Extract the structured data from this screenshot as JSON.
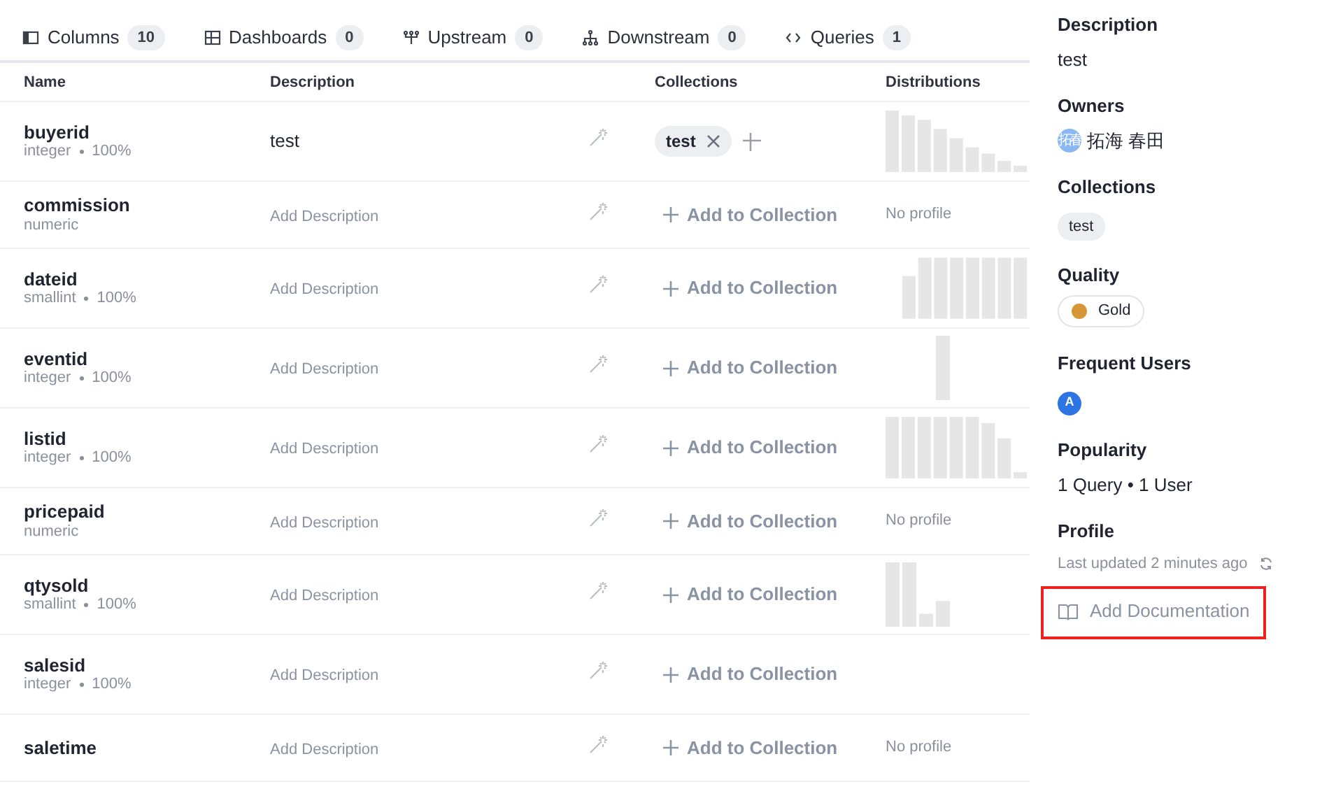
{
  "tabs": [
    {
      "label": "Columns",
      "count": "10"
    },
    {
      "label": "Dashboards",
      "count": "0"
    },
    {
      "label": "Upstream",
      "count": "0"
    },
    {
      "label": "Downstream",
      "count": "0"
    },
    {
      "label": "Queries",
      "count": "1"
    }
  ],
  "table": {
    "columns": [
      "Name",
      "Description",
      "Collections",
      "Distributions"
    ],
    "rows": [
      {
        "name": "buyerid",
        "type": "integer",
        "completeness": "100%",
        "description": "test",
        "collections": [
          "test"
        ],
        "distribution": {
          "kind": "histogram"
        }
      },
      {
        "name": "commission",
        "type": "numeric",
        "description_prompt": "Add Description",
        "add_collection": "Add to Collection",
        "distribution": {
          "kind": "text",
          "text": "No profile"
        }
      },
      {
        "name": "dateid",
        "type": "smallint",
        "completeness": "100%",
        "description_prompt": "Add Description",
        "add_collection": "Add to Collection",
        "distribution": {
          "kind": "histogram"
        }
      },
      {
        "name": "eventid",
        "type": "integer",
        "completeness": "100%",
        "description_prompt": "Add Description",
        "add_collection": "Add to Collection",
        "distribution": {
          "kind": "histogram"
        }
      },
      {
        "name": "listid",
        "type": "integer",
        "completeness": "100%",
        "description_prompt": "Add Description",
        "add_collection": "Add to Collection",
        "distribution": {
          "kind": "histogram"
        }
      },
      {
        "name": "pricepaid",
        "type": "numeric",
        "description_prompt": "Add Description",
        "add_collection": "Add to Collection",
        "distribution": {
          "kind": "text",
          "text": "No profile"
        }
      },
      {
        "name": "qtysold",
        "type": "smallint",
        "completeness": "100%",
        "description_prompt": "Add Description",
        "add_collection": "Add to Collection",
        "distribution": {
          "kind": "histogram"
        }
      },
      {
        "name": "salesid",
        "type": "integer",
        "completeness": "100%",
        "description_prompt": "Add Description",
        "add_collection": "Add to Collection"
      },
      {
        "name": "saletime",
        "description_prompt": "Add Description",
        "add_collection": "Add to Collection",
        "distribution": {
          "kind": "text",
          "text": "No profile"
        }
      }
    ]
  },
  "sidebar": {
    "description": {
      "heading": "Description",
      "text": "test"
    },
    "owners": {
      "heading": "Owners",
      "people": [
        {
          "initials": "拓春",
          "name": "拓海 春田"
        }
      ]
    },
    "collections": {
      "heading": "Collections",
      "tags": [
        "test"
      ]
    },
    "quality": {
      "heading": "Quality",
      "label": "Gold",
      "color": "#d69638"
    },
    "frequent_users": {
      "heading": "Frequent Users",
      "avatars": [
        "A"
      ]
    },
    "popularity": {
      "heading": "Popularity",
      "text": "1 Query • 1 User"
    },
    "profile": {
      "heading": "Profile",
      "updated": "Last updated 2 minutes ago"
    },
    "add_documentation": {
      "label": "Add Documentation",
      "highlighted": true
    }
  }
}
